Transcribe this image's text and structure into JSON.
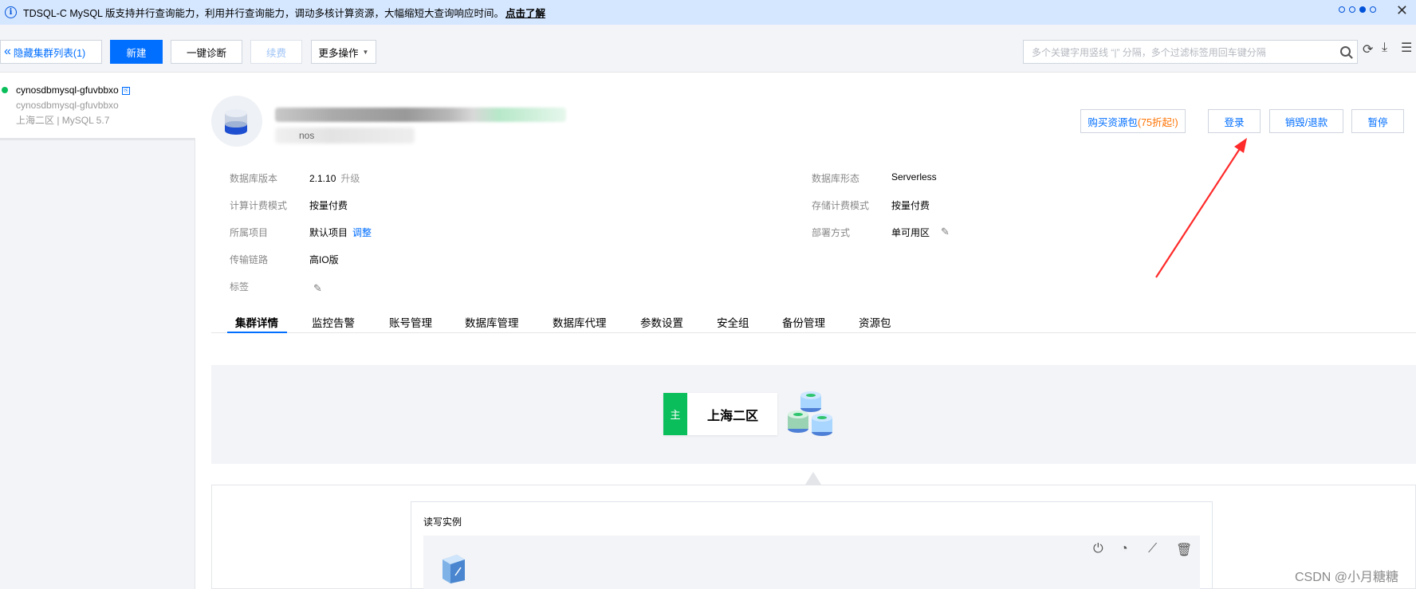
{
  "banner": {
    "message": "TDSQL-C MySQL 版支持并行查询能力，利用并行查询能力，调动多核计算资源，大幅缩短大查询响应时间。",
    "link_text": "点击了解"
  },
  "toolbar": {
    "hide_list_label": "隐藏集群列表(1)",
    "create_label": "新建",
    "diagnose_label": "一键诊断",
    "renew_label": "续费",
    "more_ops_label": "更多操作",
    "search_placeholder": "多个关键字用竖线 “|” 分隔，多个过滤标签用回车键分隔"
  },
  "cluster_list": [
    {
      "id": "cynosdbmysql-gfuvbbxo",
      "name": "cynosdbmysql-gfuvbbxo",
      "meta": "上海二区 | MySQL 5.7",
      "status_color": "#0abf5b"
    }
  ],
  "header": {
    "sub_text": "nos"
  },
  "actions": {
    "buy_label": "购买资源包",
    "buy_discount": "(75折起!)",
    "login_label": "登录",
    "destroy_label": "销毁/退款",
    "pause_label": "暂停"
  },
  "fields": {
    "db_version": {
      "label": "数据库版本",
      "value": "2.1.10",
      "sub": "升级"
    },
    "compute_billing": {
      "label": "计算计费模式",
      "value": "按量付费"
    },
    "project": {
      "label": "所属项目",
      "value": "默认项目",
      "link": "调整"
    },
    "transport": {
      "label": "传输链路",
      "value": "高IO版"
    },
    "tags": {
      "label": "标签"
    },
    "db_form": {
      "label": "数据库形态",
      "value": "Serverless"
    },
    "storage_billing": {
      "label": "存储计费模式",
      "value": "按量付费"
    },
    "deploy": {
      "label": "部署方式",
      "value": "单可用区"
    }
  },
  "tabs": [
    "集群详情",
    "监控告警",
    "账号管理",
    "数据库管理",
    "数据库代理",
    "参数设置",
    "安全组",
    "备份管理",
    "资源包"
  ],
  "topology": {
    "primary_badge": "主",
    "region": "上海二区",
    "rw_title": "读写实例"
  },
  "watermark": "CSDN @小月糖糖",
  "colors": {
    "accent": "#006eff",
    "success": "#0abf5b",
    "warning": "#ff7200",
    "annotation_arrow": "#ff2a2a"
  }
}
